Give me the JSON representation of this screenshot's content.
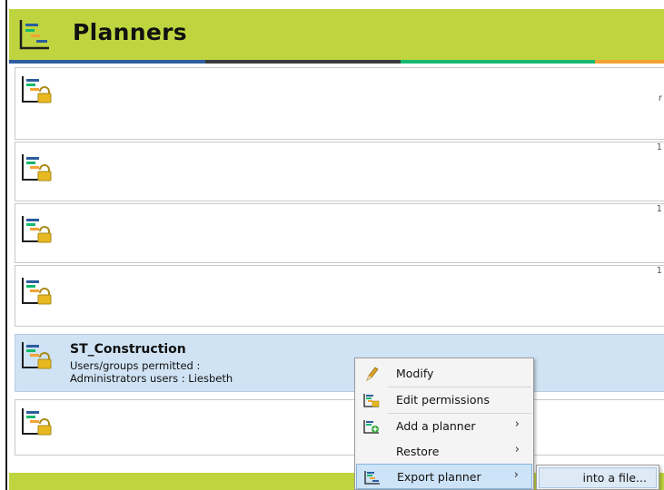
{
  "header": {
    "title": "Planners"
  },
  "colors": {
    "header_bg": "#bfd540",
    "stripe_blue": "#2c5d9e",
    "stripe_dark": "#3b3b3b",
    "stripe_green": "#14b86e",
    "stripe_orange": "#f2a334",
    "selected_row": "#cfe3f4"
  },
  "planners": [
    {
      "name": "",
      "edge_text": "r"
    },
    {
      "name": "",
      "edge_text": "1"
    },
    {
      "name": "",
      "edge_text": "1"
    },
    {
      "name": "",
      "edge_text": "1"
    },
    {
      "name": "ST_Construction",
      "users_label": "Users/groups permitted :",
      "admins_label": "Administrators users : Liesbeth",
      "selected": true
    },
    {
      "name": "",
      "edge_text": ""
    }
  ],
  "context_menu": {
    "items": [
      {
        "label": "Modify",
        "icon": "pencil-icon",
        "has_submenu": false
      },
      {
        "label": "Edit permissions",
        "icon": "planner-lock-icon",
        "has_submenu": false
      },
      {
        "label": "Add a planner",
        "icon": "planner-add-icon",
        "has_submenu": true
      },
      {
        "label": "Restore",
        "icon": "",
        "has_submenu": true
      },
      {
        "label": "Export planner",
        "icon": "planner-icon",
        "has_submenu": true,
        "active": true
      }
    ],
    "arrow": "›"
  },
  "submenu": {
    "items": [
      {
        "label": "into a file..."
      }
    ]
  }
}
